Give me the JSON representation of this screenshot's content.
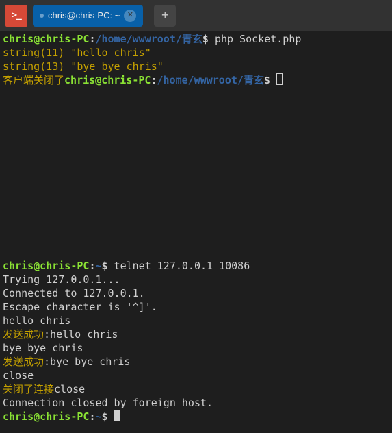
{
  "title_bar": {
    "app_icon_text": ">_",
    "tab_title": "chris@chris-PC: ~",
    "close_glyph": "✕",
    "new_tab_glyph": "+"
  },
  "pane_top": {
    "prompt1": {
      "user": "chris@chris-PC",
      "colon": ":",
      "path": "/home/wwwroot/青玄",
      "dollar": "$ ",
      "cmd": "php Socket.php"
    },
    "out1": "string(11) \"hello chris\"",
    "out2": "string(13) \"bye bye chris\"",
    "out3": "客户端关闭了",
    "prompt2": {
      "user": "chris@chris-PC",
      "colon": ":",
      "path": "/home/wwwroot/青玄",
      "dollar": "$ "
    }
  },
  "pane_bottom": {
    "prompt1": {
      "user": "chris@chris-PC",
      "colon": ":",
      "path": "~",
      "dollar": "$ ",
      "cmd": "telnet 127.0.0.1 10086"
    },
    "l1": "Trying 127.0.0.1...",
    "l2": "Connected to 127.0.0.1.",
    "l3": "Escape character is '^]'.",
    "l4": "hello chris",
    "l5a": "发送成功",
    "l5b": ":hello chris",
    "l6": "bye bye chris",
    "l7a": "发送成功",
    "l7b": ":bye bye chris",
    "l8": "close",
    "l9a": "关闭了连接",
    "l9b": "close",
    "l10": "Connection closed by foreign host.",
    "prompt2": {
      "user": "chris@chris-PC",
      "colon": ":",
      "path": "~",
      "dollar": "$ "
    }
  }
}
